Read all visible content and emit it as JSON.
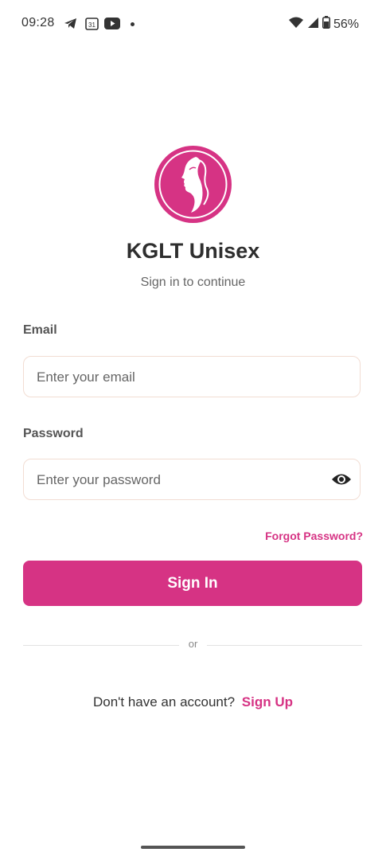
{
  "status_bar": {
    "time": "09:28",
    "calendar_day": "31",
    "battery": "56%",
    "icons": [
      "telegram-icon",
      "calendar-icon",
      "youtube-icon",
      "wifi-icon",
      "signal-icon",
      "battery-icon"
    ]
  },
  "app": {
    "title": "KGLT Unisex",
    "subtitle": "Sign in to continue",
    "brand_color": "#d63384"
  },
  "form": {
    "email_label": "Email",
    "email_placeholder": "Enter your email",
    "email_value": "",
    "password_label": "Password",
    "password_placeholder": "Enter your password",
    "password_value": "",
    "forgot_label": "Forgot Password?",
    "signin_label": "Sign In"
  },
  "divider": {
    "label": "or"
  },
  "footer": {
    "prompt": "Don't have an account?",
    "signup_label": "Sign Up"
  }
}
